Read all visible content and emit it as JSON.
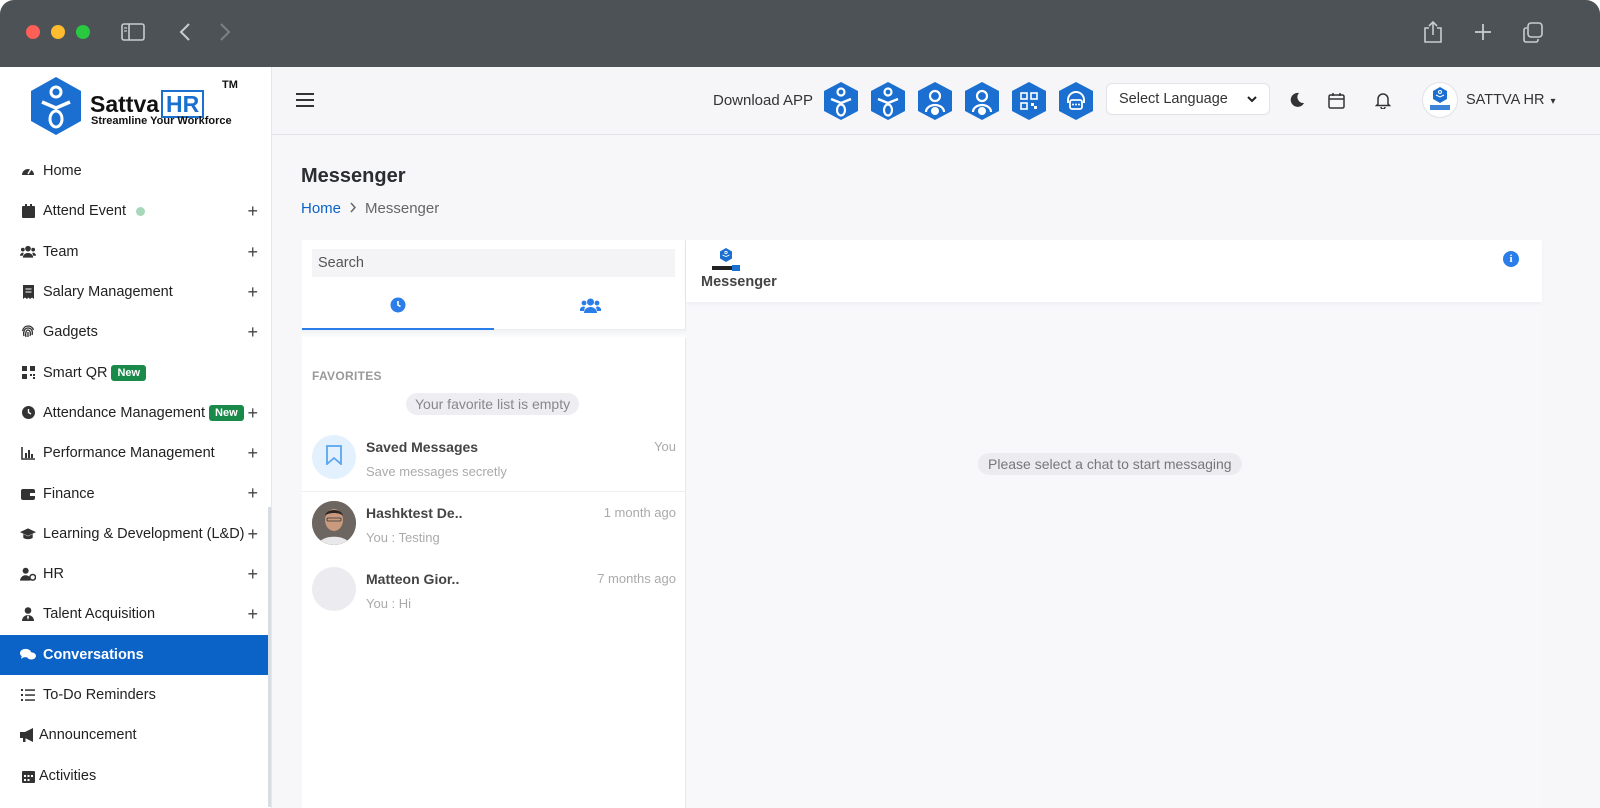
{
  "sidebar": {
    "logo": {
      "brand_text": "Sattva",
      "brand_hr": "HR",
      "tm": "TM",
      "tagline": "Streamline Your Workforce"
    },
    "items": [
      {
        "label": "Home",
        "icon": "dashboard-icon",
        "has_plus": false
      },
      {
        "label": "Attend Event",
        "icon": "calendar-icon",
        "has_plus": true,
        "dot": true
      },
      {
        "label": "Team",
        "icon": "users-icon",
        "has_plus": true
      },
      {
        "label": "Salary Management",
        "icon": "receipt-icon",
        "has_plus": true
      },
      {
        "label": "Gadgets",
        "icon": "fingerprint-icon",
        "has_plus": true
      },
      {
        "label": "Smart QR",
        "icon": "qr-icon",
        "has_plus": false,
        "badge": "New"
      },
      {
        "label": "Attendance Management",
        "icon": "clock-icon",
        "has_plus": true,
        "badge": "New"
      },
      {
        "label": "Performance Management",
        "icon": "chart-icon",
        "has_plus": true
      },
      {
        "label": "Finance",
        "icon": "wallet-icon",
        "has_plus": true
      },
      {
        "label": "Learning & Development (L&D)",
        "icon": "graduation-cap-icon",
        "has_plus": true
      },
      {
        "label": "HR",
        "icon": "user-gear-icon",
        "has_plus": true
      },
      {
        "label": "Talent Acquisition",
        "icon": "user-tie-icon",
        "has_plus": true
      },
      {
        "label": "Conversations",
        "icon": "comments-icon",
        "has_plus": false,
        "active": true
      },
      {
        "label": "To-Do Reminders",
        "icon": "list-icon",
        "has_plus": false
      },
      {
        "label": "Announcement",
        "icon": "megaphone-icon",
        "has_plus": false
      },
      {
        "label": "Activities",
        "icon": "calendar-days-icon",
        "has_plus": false
      }
    ],
    "plus_symbol": "+"
  },
  "topbar": {
    "download_label": "Download APP",
    "language": {
      "selected": "Select Language"
    },
    "user_name": "SATTVA HR"
  },
  "page": {
    "title": "Messenger",
    "breadcrumb": {
      "home": "Home",
      "current": "Messenger"
    }
  },
  "messenger": {
    "search_placeholder": "Search",
    "favorites_heading": "FAVORITES",
    "favorites_empty": "Your favorite list is empty",
    "contacts": [
      {
        "name": "Saved Messages",
        "preview": "Save messages secretly",
        "time": "You"
      },
      {
        "name": "Hashktest De..",
        "preview": "You : Testing",
        "time": "1 month ago"
      },
      {
        "name": "Matteon Gior..",
        "preview": "You : Hi",
        "time": "7 months ago"
      }
    ],
    "chat_title": "Messenger",
    "info_label": "i",
    "empty_state": "Please select a chat to start messaging"
  },
  "colors": {
    "primary": "#0b62c7",
    "accent": "#2b7de9",
    "badge_green": "#1a8a4a"
  }
}
